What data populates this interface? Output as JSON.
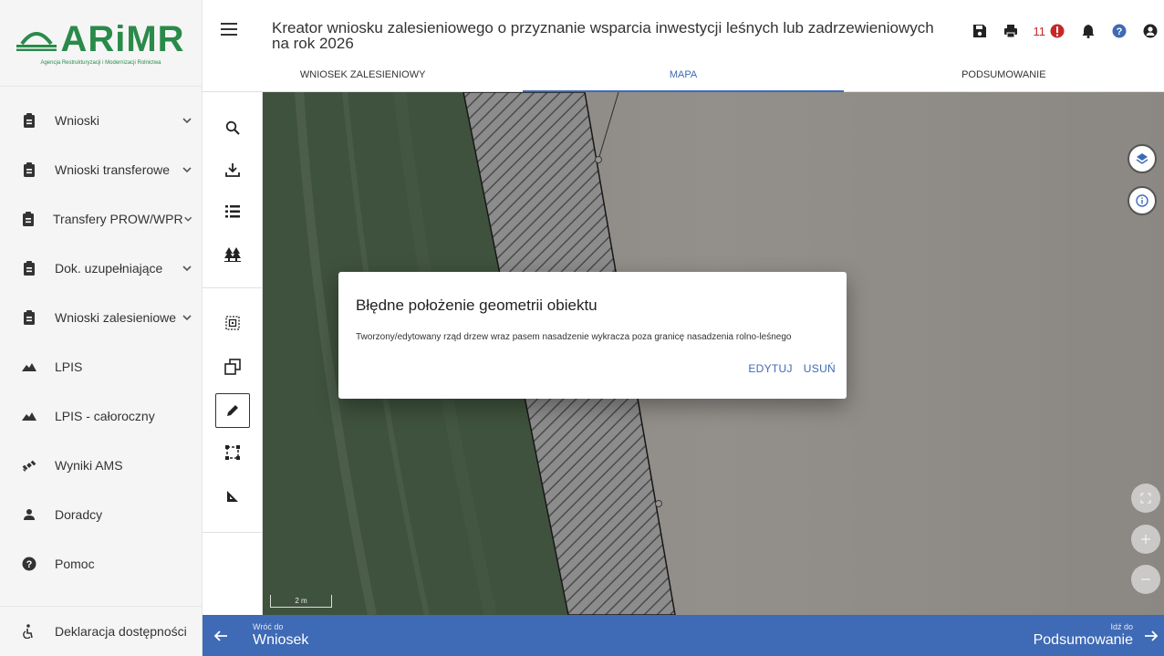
{
  "logo": {
    "name": "ARiMR",
    "subtitle": "Agencja Restrukturyzacji i Modernizacji Rolnictwa"
  },
  "sidebar": {
    "items": [
      {
        "label": "Wnioski",
        "icon": "clipboard-icon",
        "expandable": true
      },
      {
        "label": "Wnioski transferowe",
        "icon": "clipboard-icon",
        "expandable": true
      },
      {
        "label": "Transfery PROW/WPR",
        "icon": "clipboard-icon",
        "expandable": true
      },
      {
        "label": "Dok. uzupełniające",
        "icon": "clipboard-icon",
        "expandable": true
      },
      {
        "label": "Wnioski zalesieniowe",
        "icon": "clipboard-icon",
        "expandable": true
      },
      {
        "label": "LPIS",
        "icon": "mountain-icon",
        "expandable": false
      },
      {
        "label": "LPIS - całoroczny",
        "icon": "mountain-icon",
        "expandable": false
      },
      {
        "label": "Wyniki AMS",
        "icon": "satellite-icon",
        "expandable": false
      },
      {
        "label": "Doradcy",
        "icon": "person-icon",
        "expandable": false
      },
      {
        "label": "Pomoc",
        "icon": "help-icon",
        "expandable": false
      }
    ],
    "bottom": {
      "label": "Deklaracja dostępności",
      "icon": "accessibility-icon"
    }
  },
  "header": {
    "title_line1": "Kreator wniosku zalesieniowego o przyznanie wsparcia inwestycji leśnych lub zadrzewieniowych",
    "title_line2": "na rok 2026",
    "warning_count": "11",
    "tabs": [
      {
        "label": "WNIOSEK ZALESIENIOWY",
        "active": false
      },
      {
        "label": "MAPA",
        "active": true
      },
      {
        "label": "PODSUMOWANIE",
        "active": false
      }
    ],
    "accent_color": "#3f6ab5"
  },
  "map": {
    "scale_label": "2 m"
  },
  "dialog": {
    "title": "Błędne położenie geometrii obiektu",
    "message": "Tworzony/edytowany rząd drzew wraz pasem nasadzenie wykracza poza granicę nasadzenia rolno-leśnego",
    "edit_label": "EDYTUJ",
    "delete_label": "USUŃ"
  },
  "bottombar": {
    "back_small": "Wróć do",
    "back_big": "Wniosek",
    "next_small": "Idź do",
    "next_big": "Podsumowanie"
  }
}
